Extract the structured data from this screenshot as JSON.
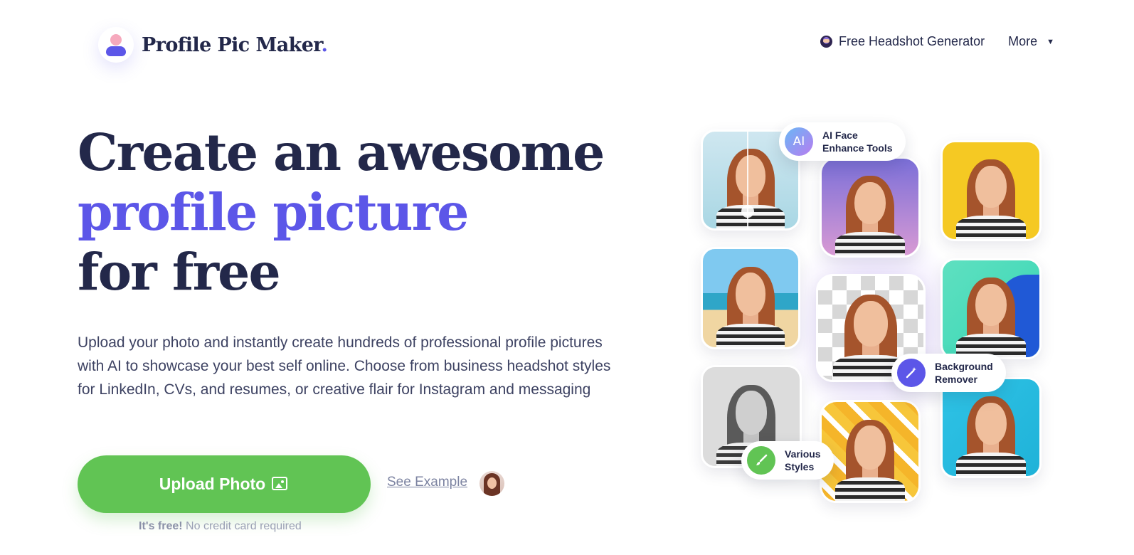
{
  "header": {
    "logo_text": "Profile Pic Maker",
    "logo_dot": ".",
    "nav": {
      "headshot_label": "Free Headshot Generator",
      "more_label": "More",
      "more_caret": "▼"
    }
  },
  "hero": {
    "title_line1": "Create an awesome",
    "title_line2": "profile picture",
    "title_line3": "for free",
    "description": "Upload your photo and instantly create hundreds of professional profile pictures with AI to showcase your best self online. Choose from business headshot styles for LinkedIn, CVs, and resumes, or creative flair for Instagram and messaging",
    "cta_label": "Upload Photo",
    "see_example_label": "See Example",
    "free_note_bold": "It's free!",
    "free_note_rest": " No credit card required"
  },
  "features": {
    "ai_icon": "AI",
    "ai_label": "AI Face\nEnhance Tools",
    "bg_label": "Background\nRemover",
    "styles_label": "Various\nStyles"
  },
  "colors": {
    "brand": "#5c56e8",
    "text_dark": "#23284a",
    "cta_green": "#61c454"
  },
  "icons": {
    "logo": "person-avatar-icon",
    "headshot": "emoji-face-icon",
    "caret": "caret-down-icon",
    "cta": "image-icon",
    "bg": "magic-wand-icon",
    "styles": "paint-brush-icon"
  }
}
